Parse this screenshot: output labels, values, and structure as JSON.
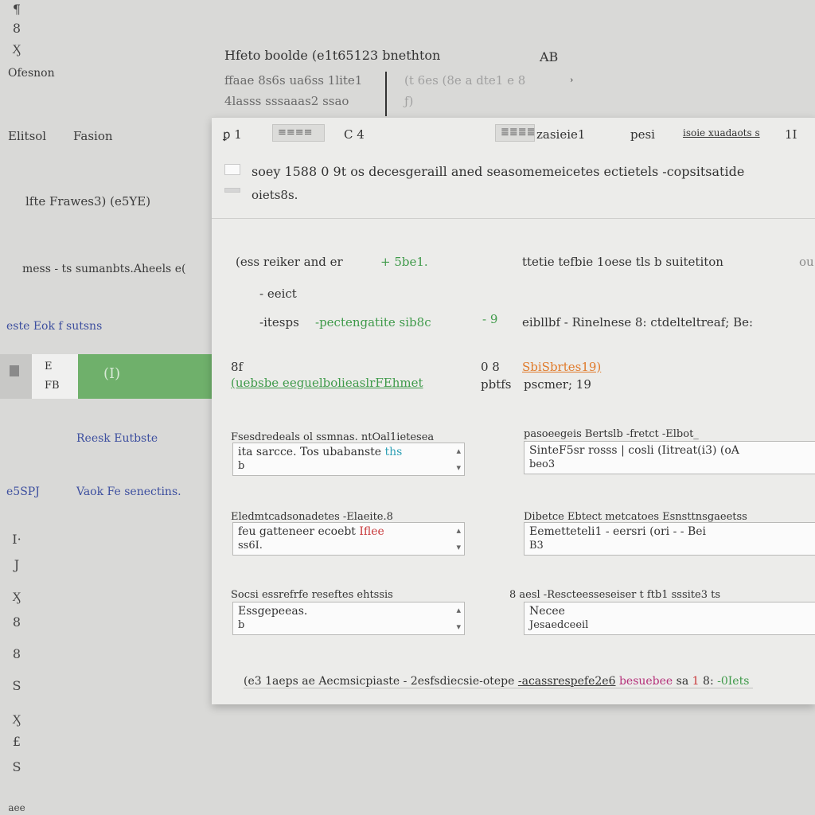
{
  "rail": {
    "icons": [
      "pin-icon",
      "ampersand-icon",
      "close-icon"
    ],
    "top_glyphs": [
      "¶",
      "8",
      "Ӽ"
    ],
    "label": "Ofesnon",
    "bottom_glyphs": [
      "I·",
      "J",
      "Ӽ",
      "8",
      "8",
      "S",
      "Ӽ",
      "£",
      "S",
      "aee"
    ]
  },
  "left_pane": {
    "tabs": [
      "Elitsol",
      "Fasion"
    ],
    "title": "lfte Frawes3) (e5YE)",
    "line": "mess - ts sumanbts.Aheels e(",
    "link": "este Eok f sutsns",
    "selected_row": {
      "mini1": "E",
      "mini2": "FB",
      "value": "(I)"
    },
    "link2": "Reesk Eutbste",
    "link3_key": "e5SPJ",
    "link3_val": "Vaok Fe senectins."
  },
  "header": {
    "title": "Hfeto boolde (e1t65123 bnethton",
    "aside": "AB",
    "sub1": "ffaae 8s6s ua6ss 1lite1",
    "sub1b": "(t 6es (8e a dte1 e 8",
    "sub2": "4lasss sssaaas2 ssao",
    "sub2b": "ƒ)"
  },
  "dialog": {
    "toolbar": {
      "left": "ꝑ 1",
      "btn1": "≡≡≡≡",
      "mid": "C  4",
      "btn2": "≣≣≣≣",
      "label": "zasieie1",
      "peer": "pesi",
      "right": "isoie xuadaots s",
      "num": "1I"
    },
    "line2": "soey  1588  0     9t    os   decesgeraill  aned  seasomemeicetes  ectietels  -copsitsatide",
    "line3": "oiets8s."
  },
  "body": {
    "r1a": "(ess reiker  and  er",
    "r1b": "+ 5be1.",
    "r1c": "ttetie tefbie 1oese tls  b  suitetiton",
    "r1d": "ou",
    "r2": "- eeict",
    "r3a": "-itesps",
    "r3b": "-pectengatite sib8c",
    "r3c": "- 9",
    "r3d": "eibllbf  -   Rinelnese  8:  ctdelteltreaf;  Be:",
    "r4a": "8f",
    "r4b": "(uebsbe eeguelbolieaslrFEhmet",
    "r4c": "0  8",
    "r4d": "SbiSbrtes19)",
    "r5a": "pbtfs",
    "r5b": "pscmer;  19"
  },
  "fields": [
    {
      "label": "Fsesdredeals ol ssmnas.  ntOal1ietesea",
      "line1": "ita sarcce.  Tos ubabanste",
      "line2": "b",
      "accent": "ths"
    },
    {
      "label": "pasoeegeis  Bertslb  -fretct -Elbot_",
      "line1": "SinteF5sr  rosss  |  cosli  (Iitreat(i3)   (oA",
      "line2": "beo3",
      "accent": ""
    },
    {
      "label": "Eledmtcadsonadetes  -Elaeite.8",
      "line1": "feu  gatteneer  ecoebt",
      "line2": "ss6I.",
      "accent": "Iflee"
    },
    {
      "label": "Dibetce  Ebtect metcatoes  Esnsttnsgaeetss",
      "line1": "Eemetteteli1  -  eersri  (ori  -  -  Bei",
      "line2": "B3",
      "accent": ""
    },
    {
      "label": "Socsi  essrefrfe  reseftes  ehtssis",
      "line1": "Essgepeeas.",
      "line2": "b",
      "accent": ""
    },
    {
      "label": "8 aesl  -Rescteesseseiser  t ftb1  sssite3  ts",
      "line1": "Necee",
      "line2": "Jesaedceeil",
      "accent": ""
    }
  ],
  "footer": {
    "a": "(e3   1aeps  ae  Aecmsicpiaste  -  2esfsdiecsie-otepe",
    "b": "-acassrespefe2e6",
    "c": "besuebee",
    "d": "sa",
    "e": "1",
    "f": "8:",
    "g": "-0Iets"
  }
}
